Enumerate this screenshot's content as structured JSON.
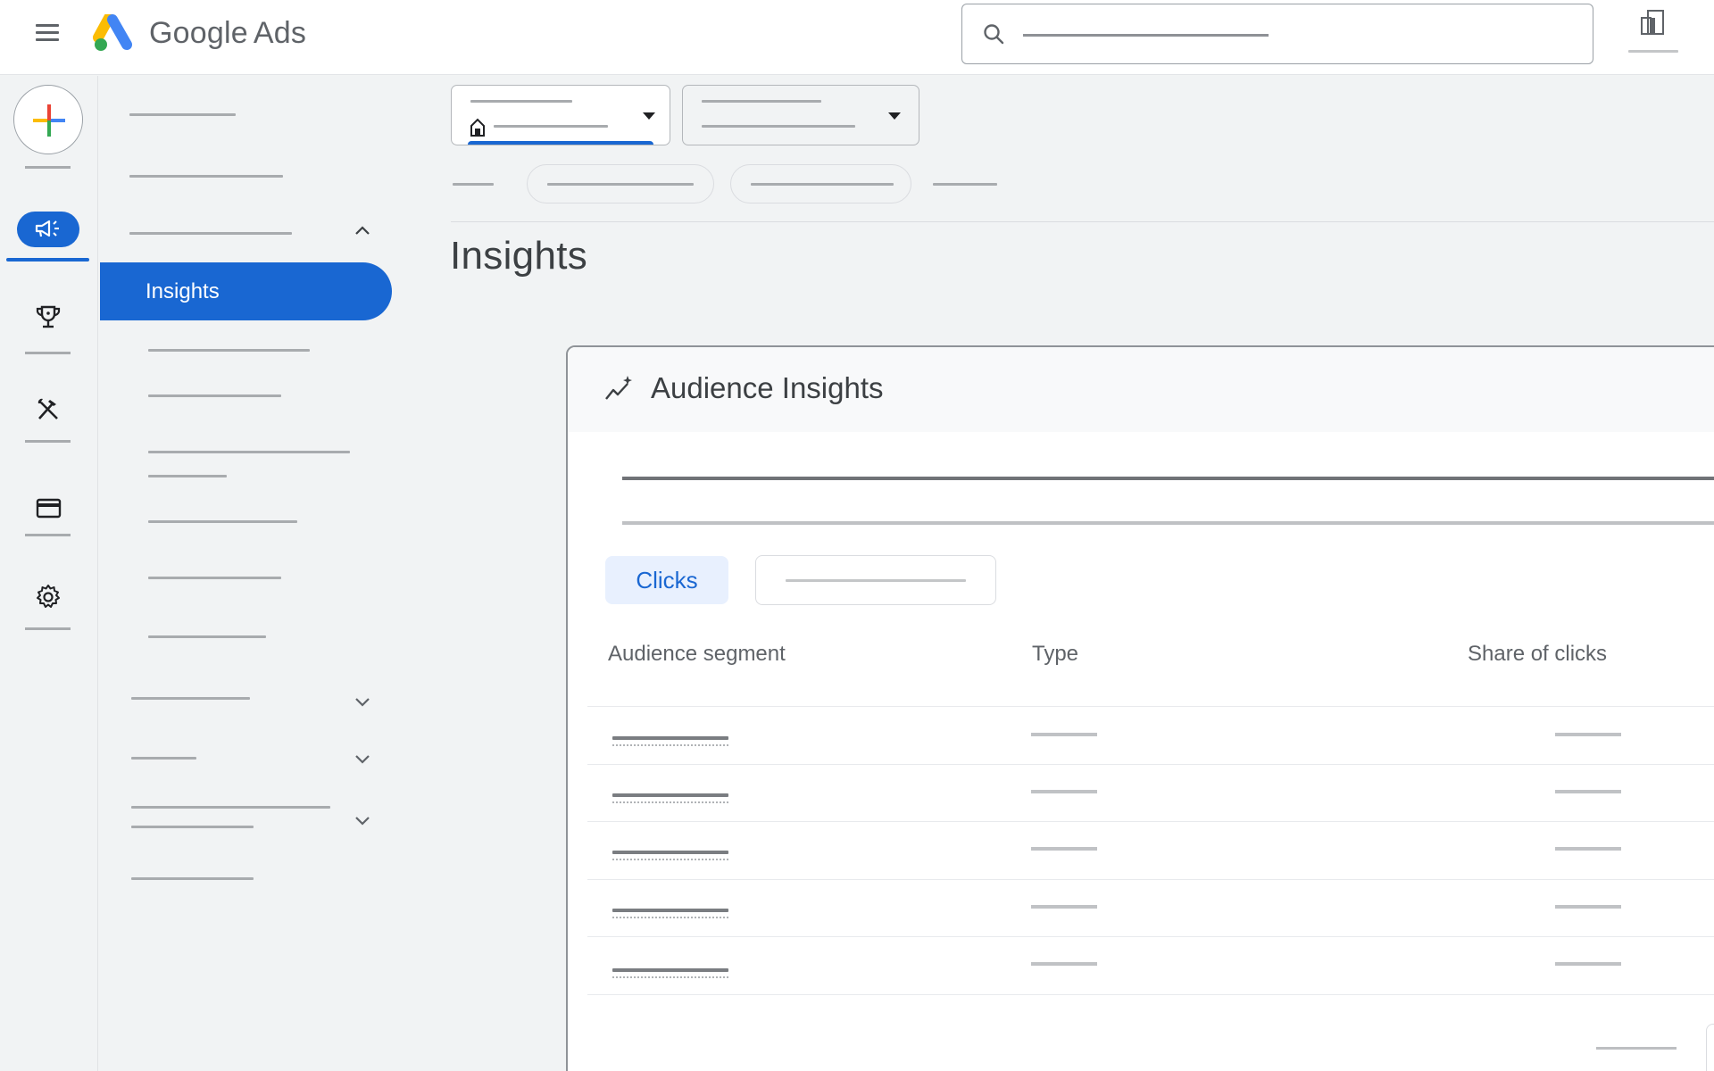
{
  "app": {
    "brand_primary": "Google",
    "brand_secondary": "Ads",
    "accent_color": "#1967d2"
  },
  "header": {
    "menu_icon": "hamburger-menu-icon",
    "search": {
      "placeholder": "",
      "value": "",
      "icon": "search-icon"
    },
    "tools_icon": "reports-icon",
    "tools_label": ""
  },
  "rail": {
    "create_icon": "plus-icon",
    "create_label": "",
    "items": [
      {
        "icon": "megaphone-icon",
        "label": "",
        "active": true
      },
      {
        "icon": "trophy-icon",
        "label": ""
      },
      {
        "icon": "tools-icon",
        "label": ""
      },
      {
        "icon": "credit-card-icon",
        "label": ""
      },
      {
        "icon": "gear-icon",
        "label": ""
      }
    ]
  },
  "nav": {
    "items": [
      {
        "label": ""
      },
      {
        "label": ""
      },
      {
        "label": "",
        "expanded": true
      },
      {
        "label": "Insights",
        "active": true
      },
      {
        "label": ""
      },
      {
        "label": ""
      },
      {
        "label": ""
      },
      {
        "label": ""
      },
      {
        "label": ""
      },
      {
        "label": "",
        "collapsed": true
      },
      {
        "label": "",
        "collapsed": true
      },
      {
        "label": "",
        "collapsed": true
      },
      {
        "label": ""
      }
    ]
  },
  "filters": {
    "account_dropdown": {
      "label": "",
      "value": "",
      "icon": "home-icon"
    },
    "campaign_dropdown": {
      "label": "",
      "value": ""
    },
    "chips": [
      "",
      ""
    ],
    "leading_label": "",
    "trailing_label": ""
  },
  "page": {
    "title": "Insights"
  },
  "card": {
    "icon": "trending-sparkle-icon",
    "title": "Audience Insights",
    "summary_lines": [
      "",
      ""
    ],
    "metric_toggle": {
      "selected": "Clicks",
      "other": ""
    },
    "table": {
      "columns": [
        "Audience segment",
        "Type",
        "Share of clicks"
      ],
      "rows": [
        {
          "segment": "",
          "type": "",
          "share": ""
        },
        {
          "segment": "",
          "type": "",
          "share": ""
        },
        {
          "segment": "",
          "type": "",
          "share": ""
        },
        {
          "segment": "",
          "type": "",
          "share": ""
        },
        {
          "segment": "",
          "type": "",
          "share": ""
        }
      ]
    },
    "footer_label": ""
  }
}
